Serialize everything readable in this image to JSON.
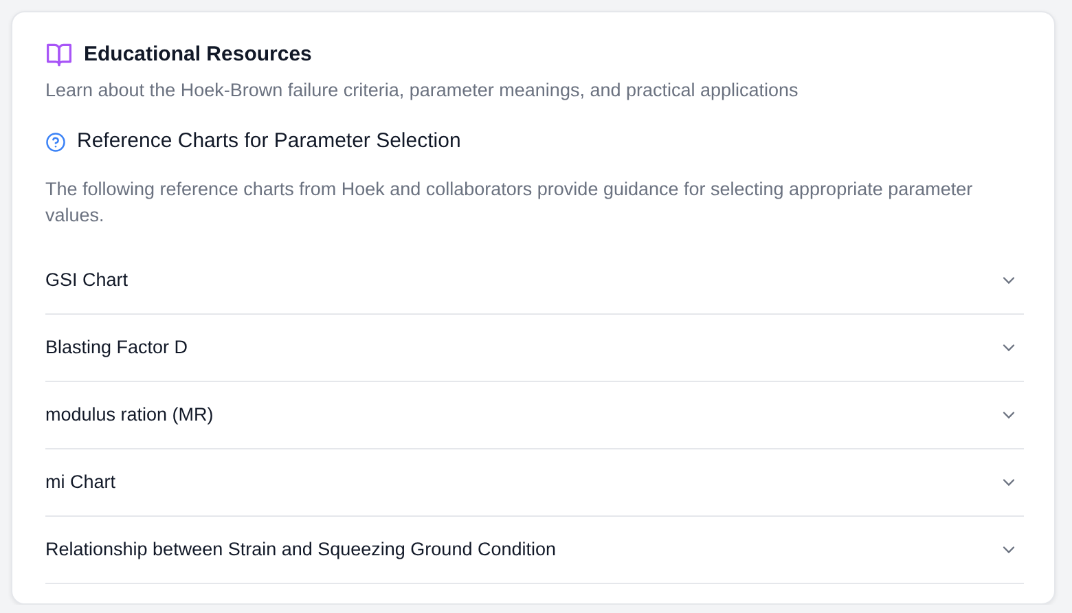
{
  "card": {
    "title": "Educational Resources",
    "subtitle": "Learn about the Hoek-Brown failure criteria, parameter meanings, and practical applications"
  },
  "section": {
    "title": "Reference Charts for Parameter Selection",
    "description": "The following reference charts from Hoek and collaborators provide guidance for selecting appropriate parameter values."
  },
  "accordion": [
    {
      "label": "GSI Chart",
      "expanded": false
    },
    {
      "label": "Blasting Factor D",
      "expanded": false
    },
    {
      "label": "modulus ration (MR)",
      "expanded": false
    },
    {
      "label": "mi Chart",
      "expanded": false
    },
    {
      "label": "Relationship between Strain and Squeezing Ground Condition",
      "expanded": false
    }
  ]
}
